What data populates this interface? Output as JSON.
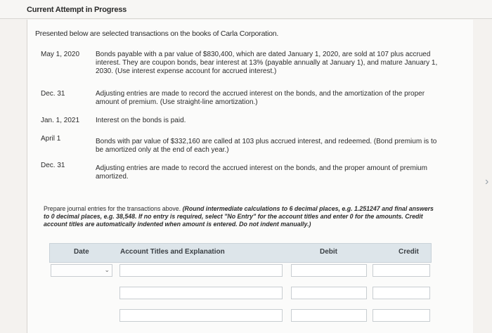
{
  "header": {
    "title": "Current Attempt in Progress"
  },
  "intro": "Presented below are selected transactions on the books of Carla Corporation.",
  "transactions": [
    {
      "date": "May 1, 2020",
      "text": "Bonds payable with a par value of $830,400, which are dated January 1, 2020, are sold at 107 plus accrued interest. They are coupon bonds, bear interest at 13% (payable annually at January 1), and mature January 1, 2030. (Use interest expense account for accrued interest.)"
    },
    {
      "date": "Dec. 31",
      "text": "Adjusting entries are made to record the accrued interest on the bonds, and the amortization of the proper amount of premium. (Use straight-line amortization.)"
    },
    {
      "date": "Jan. 1, 2021",
      "text": "Interest on the bonds is paid."
    },
    {
      "date": "April 1",
      "text": "Bonds with par value of $332,160 are called at 103 plus accrued interest, and redeemed. (Bond premium is to be amortized only at the end of each year.)"
    },
    {
      "date": "Dec. 31",
      "text": "Adjusting entries are made to record the accrued interest on the bonds, and the proper amount of premium amortized."
    }
  ],
  "instructions": {
    "main": "Prepare journal entries for the transactions above.",
    "italic": "(Round intermediate calculations to 6 decimal places, e.g. 1.251247 and final answers to 0 decimal places, e.g. 38,548. If no entry is required, select \"No Entry\" for the account titles and enter 0 for the amounts. Credit account titles are automatically indented when amount is entered. Do not indent manually.)"
  },
  "table": {
    "headers": {
      "date": "Date",
      "account": "Account Titles and Explanation",
      "debit": "Debit",
      "credit": "Credit"
    }
  },
  "icons": {
    "dropdown": "chevron-down-icon",
    "side": "chevron-right-icon"
  }
}
